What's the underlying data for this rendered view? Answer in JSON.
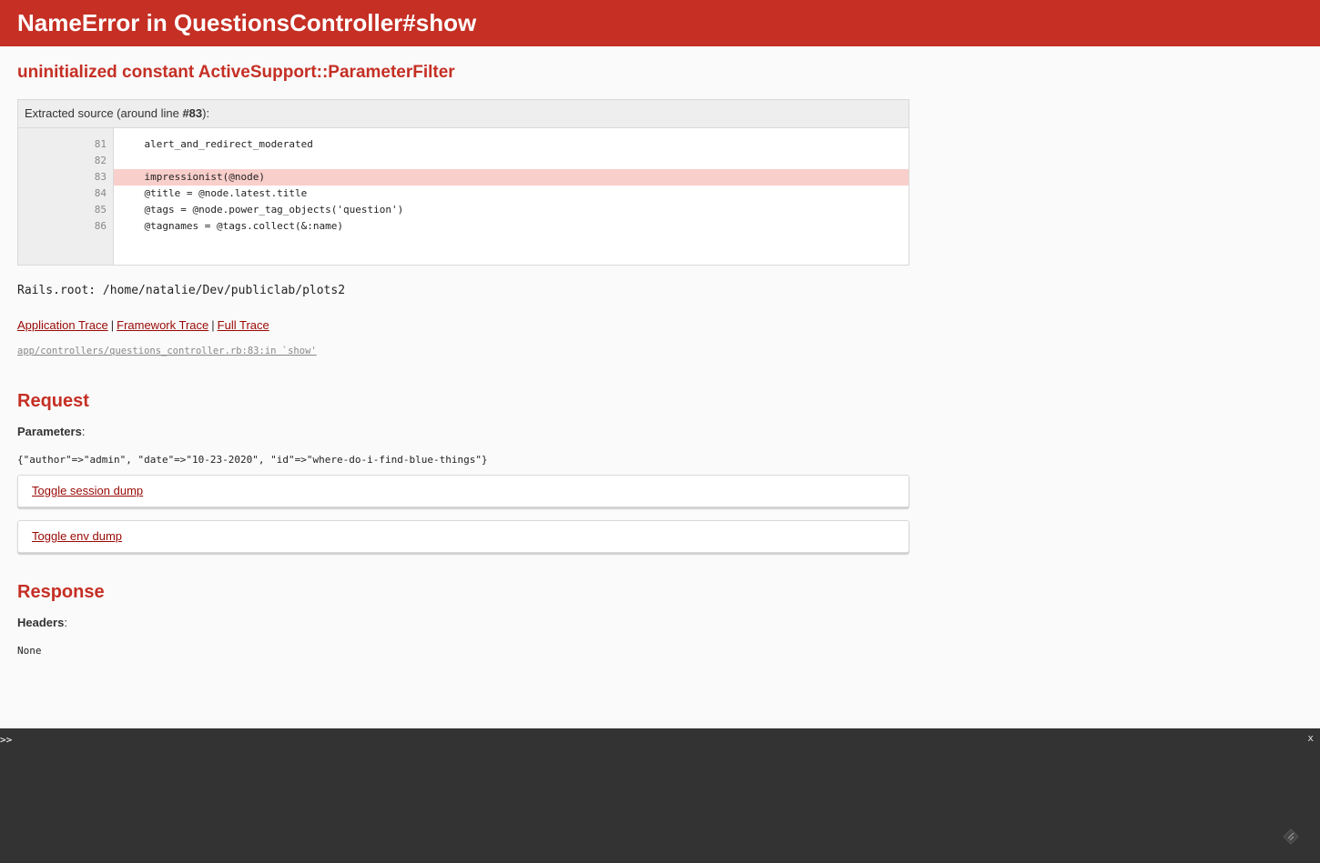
{
  "title": "NameError in QuestionsController#show",
  "error_message": "uninitialized constant ActiveSupport::ParameterFilter",
  "source": {
    "info_prefix": "Extracted source (around line ",
    "info_line": "#83",
    "info_suffix": "):",
    "line_numbers": [
      "81",
      "82",
      "83",
      "84",
      "85",
      "86"
    ],
    "lines": [
      "    alert_and_redirect_moderated",
      "",
      "    impressionist(@node)",
      "    @title = @node.latest.title",
      "    @tags = @node.power_tag_objects('question')",
      "    @tagnames = @tags.collect(&:name)"
    ]
  },
  "rails_root": "Rails.root: /home/natalie/Dev/publiclab/plots2",
  "traces": {
    "application": "Application Trace",
    "framework": "Framework Trace",
    "full": "Full Trace",
    "separator": "|"
  },
  "trace_line": "app/controllers/questions_controller.rb:83:in `show'",
  "request": {
    "heading": "Request",
    "params_label": "Parameters",
    "params_value": "{\"author\"=>\"admin\", \"date\"=>\"10-23-2020\", \"id\"=>\"where-do-i-find-blue-things\"}",
    "toggle_session": "Toggle session dump",
    "toggle_env": "Toggle env dump"
  },
  "response": {
    "heading": "Response",
    "headers_label": "Headers",
    "headers_value": "None"
  },
  "console": {
    "prompt": ">>",
    "close": "x",
    "resize_icon": "resize-handle-icon"
  },
  "colors": {
    "header_bg": "#c52f24",
    "link": "#980905",
    "highlight": "#f9cfcb",
    "console_bg": "#333333"
  }
}
